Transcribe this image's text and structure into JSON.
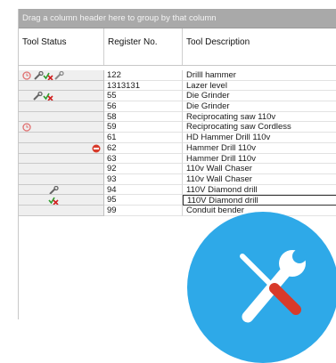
{
  "grid": {
    "group_panel_text": "Drag a column header here to group by that column",
    "columns": [
      "Tool Status",
      "Register No.",
      "Tool Description"
    ],
    "rows": [
      {
        "reg": "122",
        "desc": "Drilll hammer",
        "icons": [
          "clock-icon",
          "wrench-icon",
          "check-cross-icon",
          "wrench-gray-icon"
        ]
      },
      {
        "reg": "1313131",
        "desc": "Lazer level",
        "icons": []
      },
      {
        "reg": "55",
        "desc": "Die Grinder",
        "icons": [
          "wrench-icon",
          "check-cross-icon"
        ]
      },
      {
        "reg": "56",
        "desc": "Die Grinder",
        "icons": []
      },
      {
        "reg": "58",
        "desc": "Reciprocating saw 110v",
        "icons": []
      },
      {
        "reg": "59",
        "desc": "Reciprocating saw Cordless",
        "icons": [
          "clock-icon"
        ]
      },
      {
        "reg": "61",
        "desc": "HD Hammer Drill 110v",
        "icons": []
      },
      {
        "reg": "62",
        "desc": "Hammer Drill 110v",
        "icons": [
          "no-entry-icon"
        ]
      },
      {
        "reg": "63",
        "desc": "Hammer Drill 110v",
        "icons": []
      },
      {
        "reg": "92",
        "desc": "110v Wall Chaser",
        "icons": []
      },
      {
        "reg": "93",
        "desc": "110v Wall Chaser",
        "icons": []
      },
      {
        "reg": "94",
        "desc": "110V Diamond drill",
        "icons": [
          "wrench-icon"
        ]
      },
      {
        "reg": "95",
        "desc": "110V Diamond drill",
        "icons": [
          "check-cross-icon"
        ]
      },
      {
        "reg": "99",
        "desc": "Conduit bender",
        "icons": []
      }
    ]
  },
  "colors": {
    "badge": "#2ea9e8",
    "clock": "#e07070",
    "no_entry": "#d83a2a",
    "check": "#2e9e2e",
    "cross": "#d02020"
  }
}
